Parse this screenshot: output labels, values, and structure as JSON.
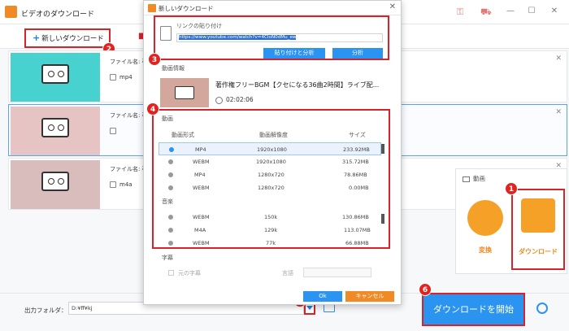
{
  "app": {
    "title": "ビデオのダウンロード"
  },
  "toolbar": {
    "new_download": "新しいダウンロード"
  },
  "rows": [
    {
      "fname": "ファイル名: 著",
      "format": "mp4"
    },
    {
      "fname": "ファイル名: 著",
      "format": ""
    },
    {
      "fname": "ファイル名: 著",
      "format": "m4a"
    }
  ],
  "dialog": {
    "title": "新しいダウンロード",
    "link_label": "リンクの貼り付け",
    "url": "https://www.youtube.com/watch?v=4CIoN0dMu_ew",
    "paste_analyze": "貼り付けと分析",
    "analyze": "分析",
    "video_info_label": "動画情報",
    "video_title": "著作権フリーBGM【クセになる36曲2時間】ライブ配...",
    "duration": "02:02:06",
    "video_label": "動画",
    "headers": {
      "format": "動画形式",
      "resolution": "動画解像度",
      "size": "サイズ"
    },
    "video_rows": [
      {
        "format": "MP4",
        "res": "1920x1080",
        "size": "233.92MB"
      },
      {
        "format": "WEBM",
        "res": "1920x1080",
        "size": "315.72MB"
      },
      {
        "format": "MP4",
        "res": "1280x720",
        "size": "78.86MB"
      },
      {
        "format": "WEBM",
        "res": "1280x720",
        "size": "0.00MB"
      }
    ],
    "audio_label": "音楽",
    "audio_rows": [
      {
        "format": "WEBM",
        "res": "150k",
        "size": "130.86MB"
      },
      {
        "format": "M4A",
        "res": "129k",
        "size": "113.07MB"
      },
      {
        "format": "WEBM",
        "res": "77k",
        "size": "66.88MB"
      }
    ],
    "subtitle_label": "字幕",
    "original_sub": "元の字幕",
    "language": "言語",
    "ok": "Ok",
    "cancel": "キャンセル"
  },
  "panel": {
    "title": "動画",
    "convert": "変換",
    "download": "ダウンロード"
  },
  "bottom": {
    "output_label": "出力フォルダ：",
    "output_path": "D:¥ff¥kj",
    "start": "ダウンロードを開始"
  },
  "badges": [
    "1",
    "2",
    "3",
    "4",
    "5",
    "6"
  ]
}
